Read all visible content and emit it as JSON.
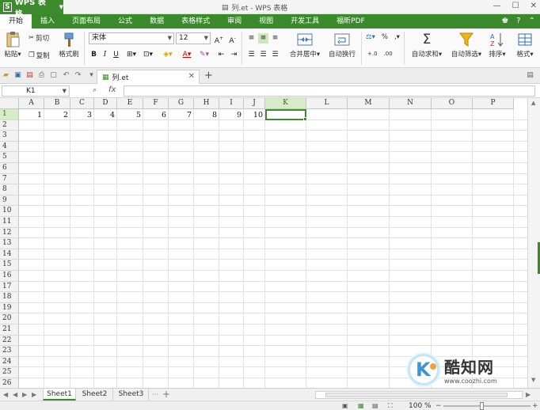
{
  "app": {
    "name": "WPS 表格",
    "window_title": "列.et - WPS 表格"
  },
  "menu_tabs": [
    "开始",
    "插入",
    "页面布局",
    "公式",
    "数据",
    "表格样式",
    "审阅",
    "视图",
    "开发工具",
    "福昕PDF"
  ],
  "ribbon": {
    "paste": "粘贴",
    "cut": "剪切",
    "copy": "复制",
    "format_painter": "格式刷",
    "font_name": "宋体",
    "font_size": "12",
    "merge_center": "合并居中",
    "wrap_text": "自动换行",
    "auto_sum": "自动求和",
    "auto_filter": "自动筛选",
    "sort": "排序",
    "format": "格式",
    "percent": "%"
  },
  "doc_tab": {
    "name": "列.et"
  },
  "formula_bar": {
    "cell_ref": "K1",
    "fx": "fx",
    "content": ""
  },
  "grid": {
    "columns": [
      "A",
      "B",
      "C",
      "D",
      "E",
      "F",
      "G",
      "H",
      "I",
      "J",
      "K",
      "L",
      "M",
      "N",
      "O",
      "P"
    ],
    "selected_column": "K",
    "selected_row": 1,
    "rows": [
      "1",
      "2",
      "3",
      "4",
      "5",
      "6",
      "7",
      "8",
      "9",
      "10",
      "11",
      "12",
      "13",
      "14",
      "15",
      "16",
      "17",
      "18",
      "19",
      "20",
      "21",
      "22",
      "23",
      "24",
      "25",
      "26"
    ],
    "row1_values": [
      "1",
      "2",
      "3",
      "4",
      "5",
      "6",
      "7",
      "8",
      "9",
      "10"
    ]
  },
  "sheets": [
    "Sheet1",
    "Sheet2",
    "Sheet3"
  ],
  "active_sheet": "Sheet1",
  "status": {
    "zoom": "100 %"
  },
  "watermark": {
    "brand": "酷知网",
    "url": "www.coozhi.com"
  },
  "colors": {
    "accent": "#3a8a2c",
    "selection": "#d7ebc9"
  }
}
